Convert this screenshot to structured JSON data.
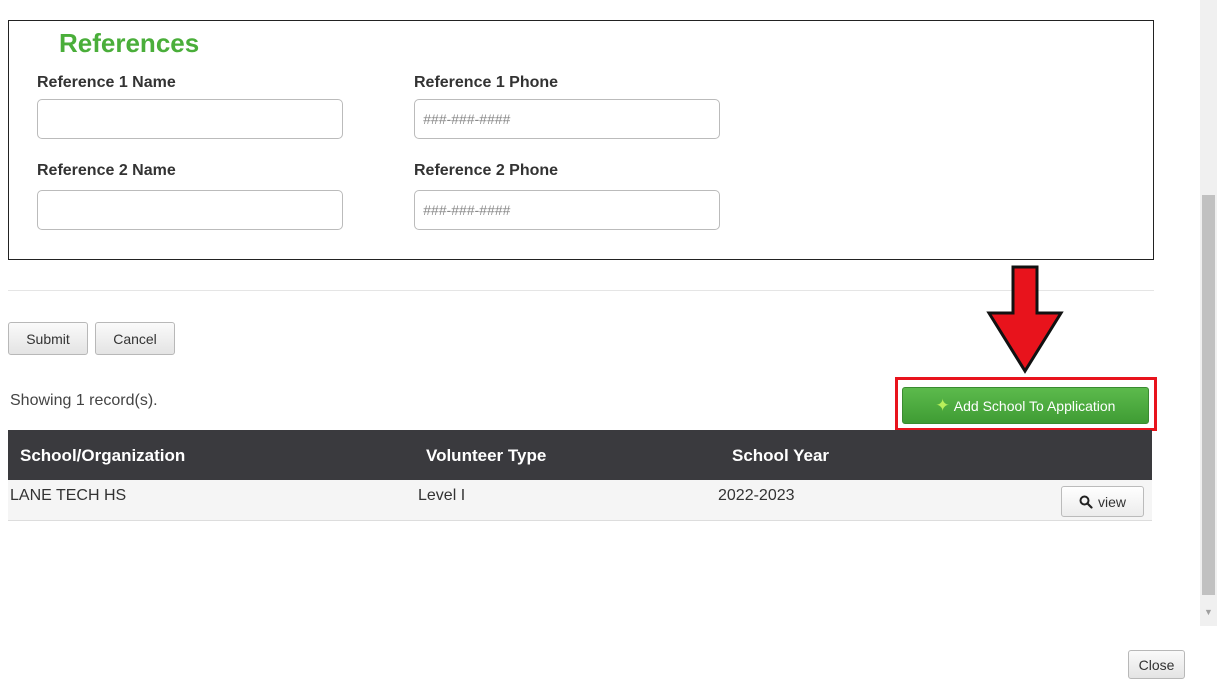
{
  "references": {
    "legend": "References",
    "ref1_name_label": "Reference 1 Name",
    "ref1_name_value": "",
    "ref1_phone_label": "Reference 1 Phone",
    "ref1_phone_placeholder": "###-###-####",
    "ref2_name_label": "Reference 2 Name",
    "ref2_name_value": "",
    "ref2_phone_label": "Reference 2 Phone",
    "ref2_phone_placeholder": "###-###-####"
  },
  "form_actions": {
    "submit_label": "Submit",
    "cancel_label": "Cancel"
  },
  "records": {
    "showing_text": "Showing 1 record(s).",
    "add_school_label": "Add School To Application",
    "columns": [
      "School/Organization",
      "Volunteer Type",
      "School Year"
    ],
    "rows": [
      {
        "school": "LANE TECH HS",
        "volunteer_type": "Level I",
        "school_year": "2022-2023",
        "view_label": "view"
      }
    ]
  },
  "footer": {
    "close_label": "Close"
  },
  "icons": {
    "add": "star-icon",
    "view": "search-icon",
    "arrow": "down-arrow-annotation-icon"
  },
  "colors": {
    "legend": "#4aae3a",
    "add_button": "#4cae3f",
    "highlight": "#e8131c",
    "table_header": "#3a3a3e"
  }
}
